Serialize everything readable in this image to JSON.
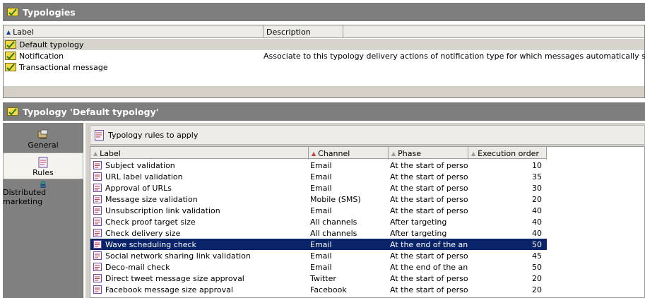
{
  "typologies": {
    "title": "Typologies",
    "columns": {
      "label": "Label",
      "description": "Description"
    },
    "rows": [
      {
        "label": "Default typology",
        "description": "",
        "selected": true
      },
      {
        "label": "Notification",
        "description": "Associate to this typology delivery actions of notification type for which messages automatically sent do not requ",
        "selected": false
      },
      {
        "label": "Transactional message",
        "description": "",
        "selected": false
      }
    ]
  },
  "detail": {
    "title": "Typology 'Default typology'",
    "sidebar": [
      {
        "label": "General",
        "icon": "general-icon",
        "active": false
      },
      {
        "label": "Rules",
        "icon": "rules-icon",
        "active": true
      },
      {
        "label": "Distributed marketing",
        "icon": "distributed-marketing-icon",
        "active": false
      }
    ],
    "toolbar_title": "Typology rules to apply",
    "rules_columns": {
      "label": "Label",
      "channel": "Channel",
      "phase": "Phase",
      "execution_order": "Execution order"
    },
    "rules": [
      {
        "label": "Subject validation",
        "channel": "Email",
        "phase": "At the start of perso...",
        "order": "10",
        "selected": false
      },
      {
        "label": "URL label validation",
        "channel": "Email",
        "phase": "At the start of perso...",
        "order": "35",
        "selected": false
      },
      {
        "label": "Approval of URLs",
        "channel": "Email",
        "phase": "At the start of perso...",
        "order": "30",
        "selected": false
      },
      {
        "label": "Message size validation",
        "channel": "Mobile (SMS)",
        "phase": "At the start of perso...",
        "order": "20",
        "selected": false
      },
      {
        "label": "Unsubscription link validation",
        "channel": "Email",
        "phase": "At the start of perso...",
        "order": "40",
        "selected": false
      },
      {
        "label": "Check proof target size",
        "channel": "All channels",
        "phase": "After targeting",
        "order": "40",
        "selected": false
      },
      {
        "label": "Check delivery size",
        "channel": "All channels",
        "phase": "After targeting",
        "order": "40",
        "selected": false
      },
      {
        "label": "Wave scheduling check",
        "channel": "Email",
        "phase": "At the end of the ana...",
        "order": "50",
        "selected": true
      },
      {
        "label": "Social network sharing link validation",
        "channel": "Email",
        "phase": "At the start of perso...",
        "order": "45",
        "selected": false
      },
      {
        "label": "Deco-mail check",
        "channel": "Email",
        "phase": "At the end of the ana...",
        "order": "50",
        "selected": false
      },
      {
        "label": "Direct tweet message size approval",
        "channel": "Twitter",
        "phase": "At the start of perso...",
        "order": "20",
        "selected": false
      },
      {
        "label": "Facebook message size approval",
        "channel": "Facebook",
        "phase": "At the start of perso...",
        "order": "20",
        "selected": false
      }
    ]
  },
  "colors": {
    "header_bg": "#7d7d7d",
    "selection": "#0a246a",
    "sidebar_bg": "#808080",
    "panel_bg": "#d4d0c8"
  }
}
